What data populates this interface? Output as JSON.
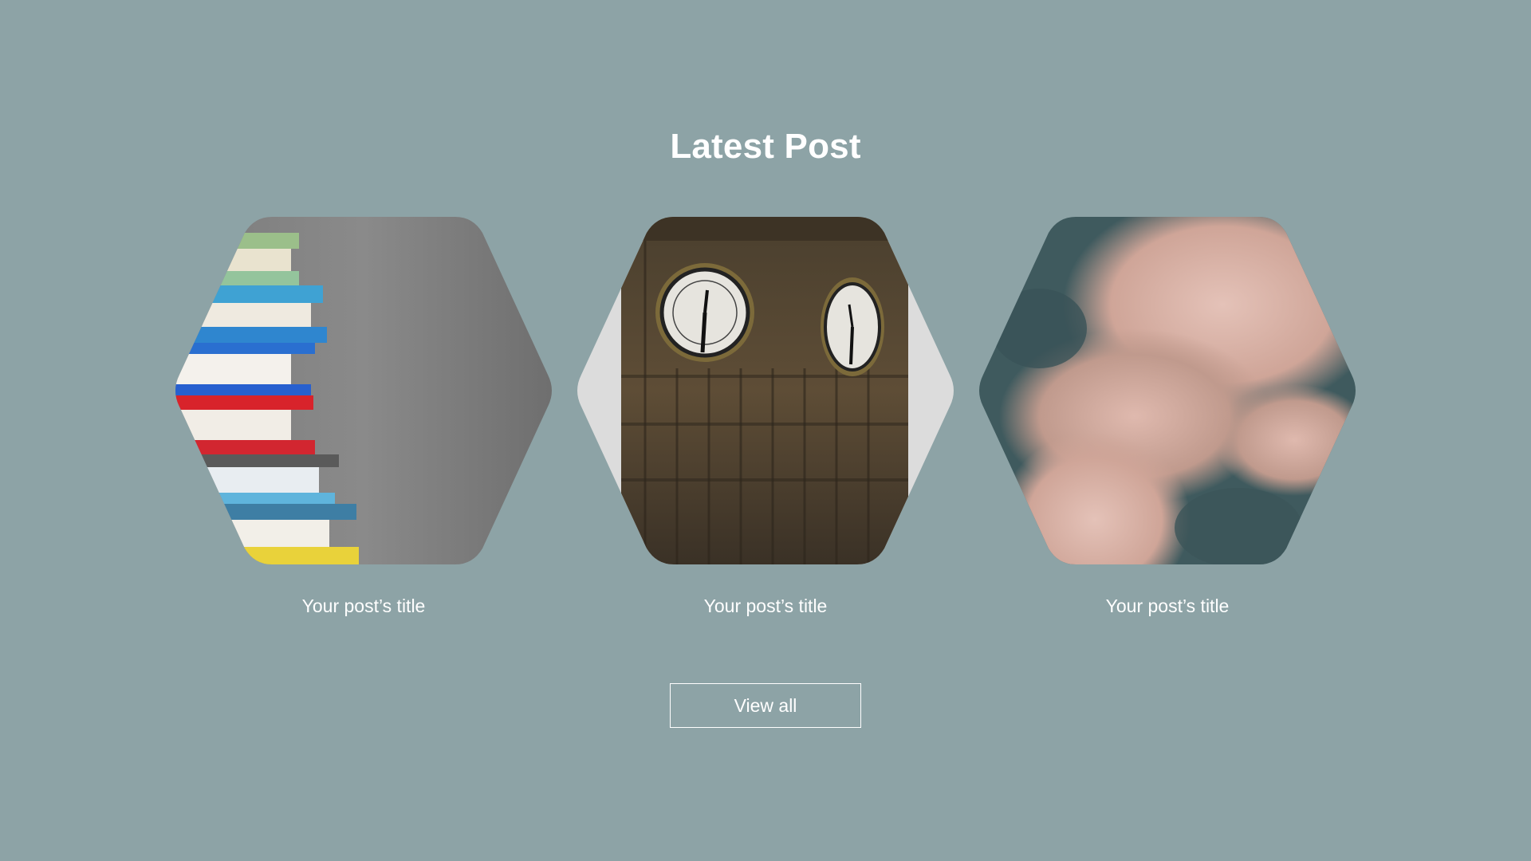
{
  "section": {
    "heading": "Latest Post",
    "posts": [
      {
        "title": "Your post’s title",
        "image": "stack-of-books-photo"
      },
      {
        "title": "Your post’s title",
        "image": "clock-tower-photo"
      },
      {
        "title": "Your post’s title",
        "image": "pink-clouds-sky-photo"
      }
    ],
    "view_all_label": "View all"
  },
  "colors": {
    "background": "#8da3a6",
    "text": "#ffffff"
  }
}
